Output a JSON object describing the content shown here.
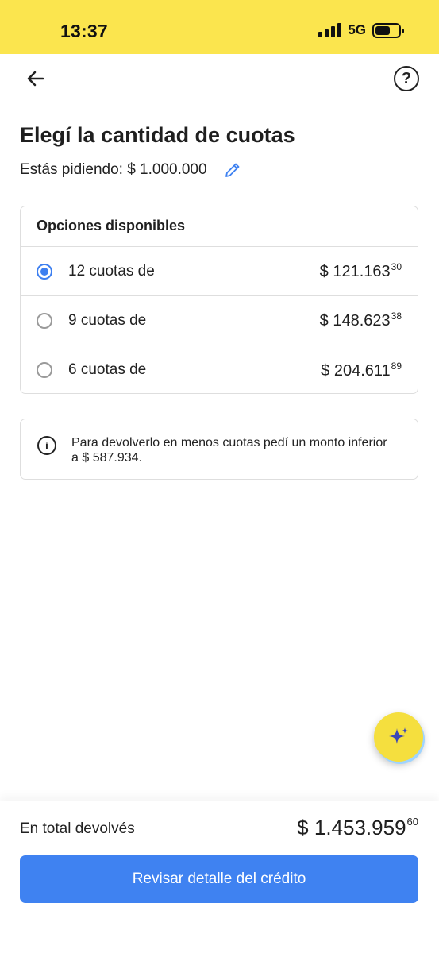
{
  "status_bar": {
    "time": "13:37",
    "network": "5G"
  },
  "header": {
    "back_icon": "arrow-left-icon",
    "help_label": "?"
  },
  "page": {
    "title": "Elegí la cantidad de cuotas",
    "requesting_text": "Estás pidiendo: $ 1.000.000"
  },
  "options": {
    "header": "Opciones disponibles",
    "items": [
      {
        "label": "12 cuotas de",
        "amount": "$ 121.163",
        "cents": "30",
        "selected": true
      },
      {
        "label": "9 cuotas de",
        "amount": "$ 148.623",
        "cents": "38",
        "selected": false
      },
      {
        "label": "6 cuotas de",
        "amount": "$ 204.611",
        "cents": "89",
        "selected": false
      }
    ]
  },
  "info": {
    "text": "Para devolverlo en menos cuotas pedí un monto inferior a $ 587.934."
  },
  "footer": {
    "total_label": "En total devolvés",
    "total_amount": "$ 1.453.959",
    "total_cents": "60",
    "button_label": "Revisar detalle del crédito"
  },
  "colors": {
    "accent": "#3f82f1",
    "status_bar": "#fbe54e",
    "fab": "#f5df3e"
  }
}
